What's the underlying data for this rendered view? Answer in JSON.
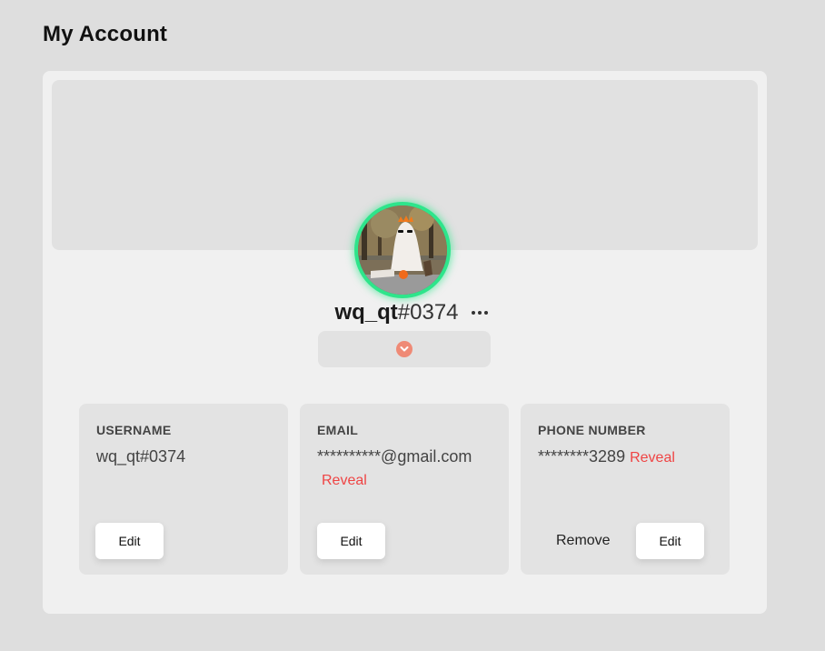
{
  "page": {
    "title": "My Account"
  },
  "profile": {
    "name": "wq_qt",
    "tag": "#0374",
    "status_color": "#2ee58b"
  },
  "fields": {
    "username": {
      "label": "USERNAME",
      "value": "wq_qt#0374",
      "edit_label": "Edit"
    },
    "email": {
      "label": "EMAIL",
      "value": "**********@gmail.com",
      "reveal_label": "Reveal",
      "edit_label": "Edit"
    },
    "phone": {
      "label": "PHONE NUMBER",
      "value": "********3289",
      "reveal_label": "Reveal",
      "remove_label": "Remove",
      "edit_label": "Edit"
    }
  },
  "icons": {
    "more": "more-icon",
    "expand": "chevron-down-icon"
  },
  "colors": {
    "accent_link": "#ef4444",
    "chevron_bg": "#ef8a76",
    "card_bg": "#f0f0f0"
  }
}
